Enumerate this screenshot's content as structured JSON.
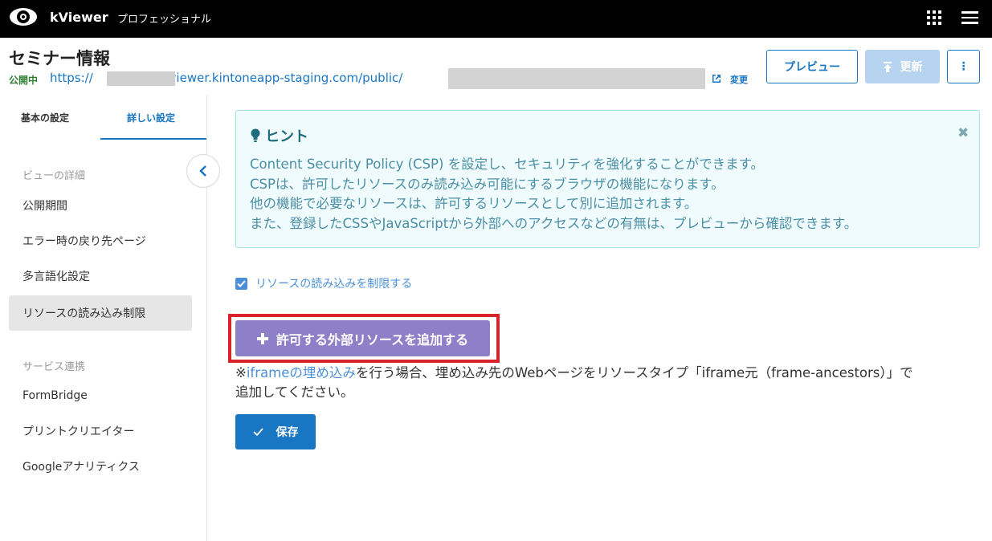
{
  "topbar": {
    "app_name": "kViewer",
    "plan": "プロフェッショナル",
    "icons": [
      "eye-logo-icon",
      "apps-grid-icon",
      "hamburger-menu-icon"
    ]
  },
  "header": {
    "title": "セミナー情報",
    "status": "公開中",
    "url_prefix": "https://",
    "url_middle": ".viewer.kintoneapp-staging.com/public/",
    "change_label": "変更",
    "preview_label": "プレビュー",
    "update_label": "更新",
    "more_label": "⋮"
  },
  "sidebar": {
    "tabs": [
      "基本の設定",
      "詳しい設定"
    ],
    "active_tab": "詳しい設定",
    "section_view": "ビューの詳細",
    "view_items": [
      "公開期間",
      "エラー時の戻り先ページ",
      "多言語化設定",
      "リソースの読み込み制限"
    ],
    "active_item": "リソースの読み込み制限",
    "section_service": "サービス連携",
    "service_items": [
      "FormBridge",
      "プリントクリエイター",
      "Googleアナリティクス"
    ]
  },
  "hint": {
    "title": "ヒント",
    "lines": [
      "Content Security Policy (CSP) を設定し、セキュリティを強化することができます。",
      "CSPは、許可したリソースのみ読み込み可能にするブラウザの機能になります。",
      "他の機能で必要なリソースは、許可するリソースとして別に追加されます。",
      "また、登録したCSSやJavaScriptから外部へのアクセスなどの有無は、プレビューから確認できます。"
    ]
  },
  "main": {
    "restrict_checkbox_label": "リソースの読み込みを制限する",
    "restrict_checked": true,
    "add_button_label": "許可する外部リソースを追加する",
    "note_prefix": "※",
    "note_link": "iframeの埋め込み",
    "note_rest": "を行う場合、埋め込み先のWebページをリソースタイプ「iframe元（frame-ancestors）」で追加してください。",
    "save_label": "保存"
  },
  "colors": {
    "primary": "#1976c2",
    "status_green": "#2e7d32",
    "add_button": "#8e80c8",
    "highlight": "#d9232a",
    "hint_bg": "#f0fbfd"
  }
}
